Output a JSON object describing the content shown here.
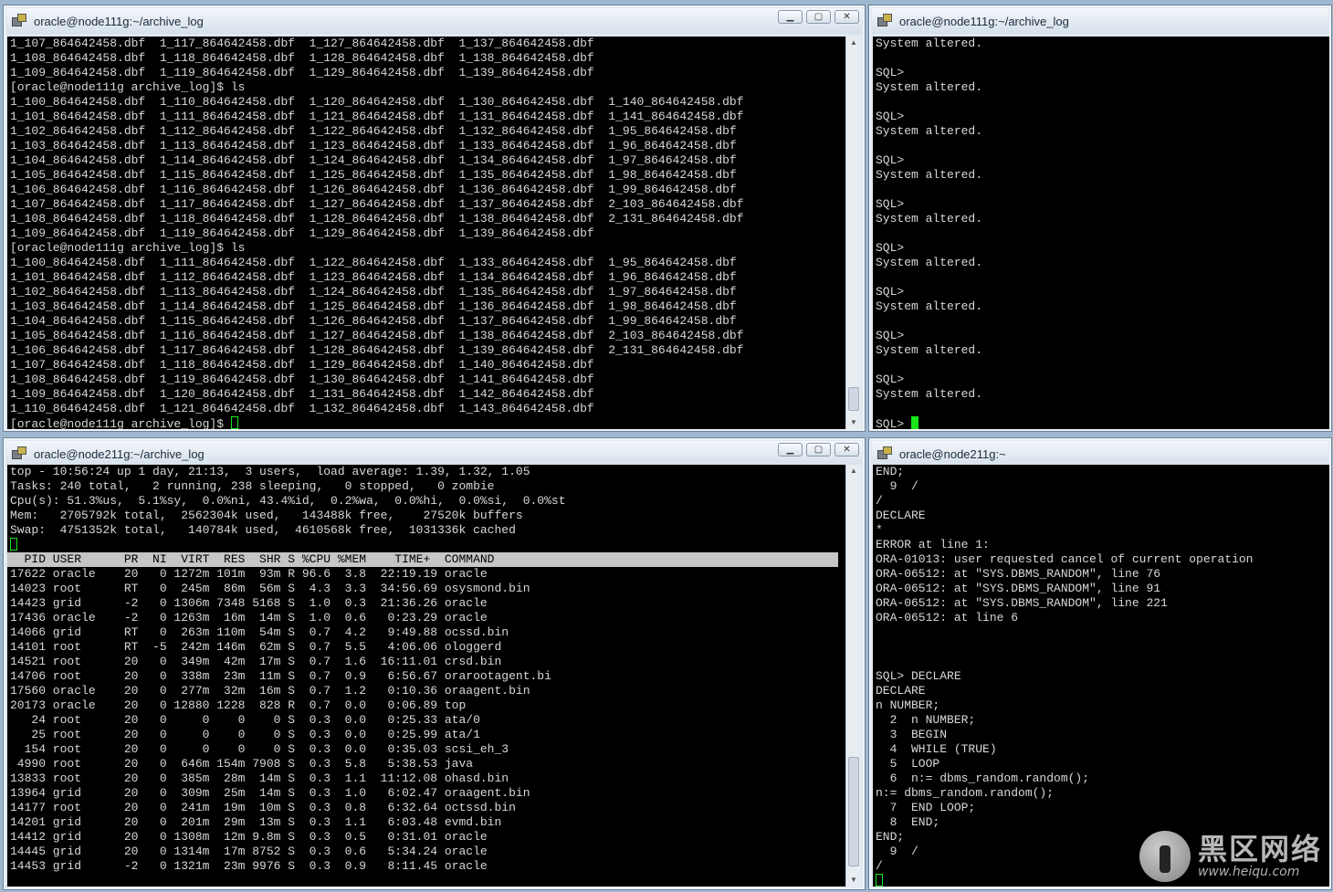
{
  "windows": {
    "top_left": {
      "title": "oracle@node111g:~/archive_log",
      "lines": [
        "1_107_864642458.dbf  1_117_864642458.dbf  1_127_864642458.dbf  1_137_864642458.dbf",
        "1_108_864642458.dbf  1_118_864642458.dbf  1_128_864642458.dbf  1_138_864642458.dbf",
        "1_109_864642458.dbf  1_119_864642458.dbf  1_129_864642458.dbf  1_139_864642458.dbf",
        "[oracle@node111g archive_log]$ ls",
        "1_100_864642458.dbf  1_110_864642458.dbf  1_120_864642458.dbf  1_130_864642458.dbf  1_140_864642458.dbf",
        "1_101_864642458.dbf  1_111_864642458.dbf  1_121_864642458.dbf  1_131_864642458.dbf  1_141_864642458.dbf",
        "1_102_864642458.dbf  1_112_864642458.dbf  1_122_864642458.dbf  1_132_864642458.dbf  1_95_864642458.dbf",
        "1_103_864642458.dbf  1_113_864642458.dbf  1_123_864642458.dbf  1_133_864642458.dbf  1_96_864642458.dbf",
        "1_104_864642458.dbf  1_114_864642458.dbf  1_124_864642458.dbf  1_134_864642458.dbf  1_97_864642458.dbf",
        "1_105_864642458.dbf  1_115_864642458.dbf  1_125_864642458.dbf  1_135_864642458.dbf  1_98_864642458.dbf",
        "1_106_864642458.dbf  1_116_864642458.dbf  1_126_864642458.dbf  1_136_864642458.dbf  1_99_864642458.dbf",
        "1_107_864642458.dbf  1_117_864642458.dbf  1_127_864642458.dbf  1_137_864642458.dbf  2_103_864642458.dbf",
        "1_108_864642458.dbf  1_118_864642458.dbf  1_128_864642458.dbf  1_138_864642458.dbf  2_131_864642458.dbf",
        "1_109_864642458.dbf  1_119_864642458.dbf  1_129_864642458.dbf  1_139_864642458.dbf",
        "[oracle@node111g archive_log]$ ls",
        "1_100_864642458.dbf  1_111_864642458.dbf  1_122_864642458.dbf  1_133_864642458.dbf  1_95_864642458.dbf",
        "1_101_864642458.dbf  1_112_864642458.dbf  1_123_864642458.dbf  1_134_864642458.dbf  1_96_864642458.dbf",
        "1_102_864642458.dbf  1_113_864642458.dbf  1_124_864642458.dbf  1_135_864642458.dbf  1_97_864642458.dbf",
        "1_103_864642458.dbf  1_114_864642458.dbf  1_125_864642458.dbf  1_136_864642458.dbf  1_98_864642458.dbf",
        "1_104_864642458.dbf  1_115_864642458.dbf  1_126_864642458.dbf  1_137_864642458.dbf  1_99_864642458.dbf",
        "1_105_864642458.dbf  1_116_864642458.dbf  1_127_864642458.dbf  1_138_864642458.dbf  2_103_864642458.dbf",
        "1_106_864642458.dbf  1_117_864642458.dbf  1_128_864642458.dbf  1_139_864642458.dbf  2_131_864642458.dbf",
        "1_107_864642458.dbf  1_118_864642458.dbf  1_129_864642458.dbf  1_140_864642458.dbf",
        "1_108_864642458.dbf  1_119_864642458.dbf  1_130_864642458.dbf  1_141_864642458.dbf",
        "1_109_864642458.dbf  1_120_864642458.dbf  1_131_864642458.dbf  1_142_864642458.dbf",
        "1_110_864642458.dbf  1_121_864642458.dbf  1_132_864642458.dbf  1_143_864642458.dbf"
      ],
      "prompt": "[oracle@node111g archive_log]$ "
    },
    "top_right": {
      "title": "oracle@node111g:~/archive_log",
      "lines": [
        "System altered.",
        "",
        "SQL>",
        "System altered.",
        "",
        "SQL>",
        "System altered.",
        "",
        "SQL>",
        "System altered.",
        "",
        "SQL>",
        "System altered.",
        "",
        "SQL>",
        "System altered.",
        "",
        "SQL>",
        "System altered.",
        "",
        "SQL>",
        "System altered.",
        "",
        "SQL>",
        "System altered.",
        ""
      ],
      "prompt": "SQL> "
    },
    "bottom_left": {
      "title": "oracle@node211g:~/archive_log",
      "summary": [
        "top - 10:56:24 up 1 day, 21:13,  3 users,  load average: 1.39, 1.32, 1.05",
        "Tasks: 240 total,   2 running, 238 sleeping,   0 stopped,   0 zombie",
        "Cpu(s): 51.3%us,  5.1%sy,  0.0%ni, 43.4%id,  0.2%wa,  0.0%hi,  0.0%si,  0.0%st",
        "Mem:   2705792k total,  2562304k used,   143488k free,    27520k buffers",
        "Swap:  4751352k total,   140784k used,  4610568k free,  1031336k cached"
      ],
      "header": "  PID USER      PR  NI  VIRT  RES  SHR S %CPU %MEM    TIME+  COMMAND",
      "rows": [
        "17622 oracle    20   0 1272m 101m  93m R 96.6  3.8  22:19.19 oracle",
        "14023 root      RT   0  245m  86m  56m S  4.3  3.3  34:56.69 osysmond.bin",
        "14423 grid      -2   0 1306m 7348 5168 S  1.0  0.3  21:36.26 oracle",
        "17436 oracle    -2   0 1263m  16m  14m S  1.0  0.6   0:23.29 oracle",
        "14066 grid      RT   0  263m 110m  54m S  0.7  4.2   9:49.88 ocssd.bin",
        "14101 root      RT  -5  242m 146m  62m S  0.7  5.5   4:06.06 ologgerd",
        "14521 root      20   0  349m  42m  17m S  0.7  1.6  16:11.01 crsd.bin",
        "14706 root      20   0  338m  23m  11m S  0.7  0.9   6:56.67 orarootagent.bi",
        "17560 oracle    20   0  277m  32m  16m S  0.7  1.2   0:10.36 oraagent.bin",
        "20173 oracle    20   0 12880 1228  828 R  0.7  0.0   0:06.89 top",
        "   24 root      20   0     0    0    0 S  0.3  0.0   0:25.33 ata/0",
        "   25 root      20   0     0    0    0 S  0.3  0.0   0:25.99 ata/1",
        "  154 root      20   0     0    0    0 S  0.3  0.0   0:35.03 scsi_eh_3",
        " 4990 root      20   0  646m 154m 7908 S  0.3  5.8   5:38.53 java",
        "13833 root      20   0  385m  28m  14m S  0.3  1.1  11:12.08 ohasd.bin",
        "13964 grid      20   0  309m  25m  14m S  0.3  1.0   6:02.47 oraagent.bin",
        "14177 root      20   0  241m  19m  10m S  0.3  0.8   6:32.64 octssd.bin",
        "14201 grid      20   0  201m  29m  13m S  0.3  1.1   6:03.48 evmd.bin",
        "14412 grid      20   0 1308m  12m 9.8m S  0.3  0.5   0:31.01 oracle",
        "14445 grid      20   0 1314m  17m 8752 S  0.3  0.6   5:34.24 oracle",
        "14453 grid      -2   0 1321m  23m 9976 S  0.3  0.9   8:11.45 oracle"
      ]
    },
    "bottom_right": {
      "title": "oracle@node211g:~",
      "lines": [
        "END;",
        "  9  /",
        "/",
        "DECLARE",
        "*",
        "ERROR at line 1:",
        "ORA-01013: user requested cancel of current operation",
        "ORA-06512: at \"SYS.DBMS_RANDOM\", line 76",
        "ORA-06512: at \"SYS.DBMS_RANDOM\", line 91",
        "ORA-06512: at \"SYS.DBMS_RANDOM\", line 221",
        "ORA-06512: at line 6",
        "",
        "",
        "",
        "SQL> DECLARE",
        "DECLARE",
        "n NUMBER;",
        "  2  n NUMBER;",
        "  3  BEGIN",
        "  4  WHILE (TRUE)",
        "  5  LOOP",
        "  6  n:= dbms_random.random();",
        "n:= dbms_random.random();",
        "  7  END LOOP;",
        "  8  END;",
        "END;",
        "  9  /",
        "/"
      ]
    }
  },
  "watermark": {
    "brand_cn": "黑区网络",
    "url": "www.heiqu.com"
  },
  "colors": {
    "terminal_bg": "#000000",
    "terminal_fg": "#d8d8d8",
    "cursor": "#19e619",
    "header_bg": "#c6c6c6"
  }
}
